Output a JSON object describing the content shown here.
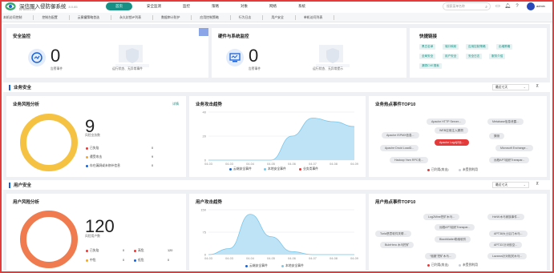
{
  "app": {
    "title": "深信服入侵防御系统",
    "version": "8.0.85",
    "subtitle": "AF80001 AF",
    "user": "admin"
  },
  "nav": [
    "首页",
    "安全监测",
    "监控",
    "策略",
    "对象",
    "网络",
    "系统"
  ],
  "search": {
    "placeholder": "搜索菜单名称"
  },
  "tabs": [
    "本机访问控制",
    "控制台配置",
    "云蜜罐策略首选",
    "永久封锁IP列表",
    "数据审计防护",
    "应用控制策略",
    "行为日志",
    "用户安全",
    "单机访问列表"
  ],
  "security_monitor": {
    "title": "安全监控",
    "count": "0",
    "label": "告警事件",
    "hint": "运行状态、无异常事件"
  },
  "hardware": {
    "title": "硬件与系统监控",
    "count": "0",
    "label": "告警事件",
    "hint": "运行状态、无异常提示"
  },
  "quick_links": {
    "title": "快捷链接",
    "items": [
      "黑白名单",
      "端口映射",
      "应用控制策略",
      "出墙策略",
      "全局安全",
      "用户安全",
      "安全日志",
      "服务介绍",
      "漏洞CVE搜索"
    ]
  },
  "business": {
    "section_title": "业务安全",
    "range": "最近七天",
    "risk": {
      "title": "业务风险分析",
      "link": "详情",
      "count": "9",
      "label": "风险业务数",
      "rows": [
        {
          "label": "已失陷",
          "value": "0",
          "color": "#e5393a"
        },
        {
          "label": "遭受攻击",
          "value": "9",
          "color": "#f5a623"
        },
        {
          "label": "存在漏洞或未修补信息",
          "value": "0",
          "color": "#1a63d6"
        }
      ]
    },
    "trend": {
      "title": "业务攻击趋势",
      "legend": [
        "云端安全事件",
        "本地安全事件",
        "业务类事件"
      ]
    },
    "top10": {
      "title": "业务热点事件TOP10",
      "legend": [
        "已利用(攻击)",
        "未受到利用"
      ],
      "tags": [
        "Apache HTTP Server...",
        "Metabase信息泄露...",
        "WEB应用注入漏洞",
        "Apache ISPMX信息...",
        "Apache Log4j2远...",
        "猜测",
        "Apache Druid LoadD...",
        "Microsoft Exchange...",
        "Hadoop Yarn RPC未...",
        "远程APT组织Transpar..."
      ]
    }
  },
  "user": {
    "section_title": "用户安全",
    "range": "最近七天",
    "risk": {
      "title": "用户风险分析",
      "count": "120",
      "label": "风险用户数",
      "rows": [
        {
          "label": "已失陷",
          "value": "0",
          "color": "#e5393a"
        },
        {
          "label": "中危",
          "value": "0",
          "color": "#f5a623"
        },
        {
          "label": "高危",
          "value": "120",
          "color": "#e5393a"
        },
        {
          "label": "低危",
          "value": "0",
          "color": "#1a63d6"
        }
      ]
    },
    "trend": {
      "title": "用户攻击趋势",
      "legend": [
        "云端安全事件",
        "本地安全事件"
      ]
    },
    "top10": {
      "title": "用户热点事件TOP10",
      "legend": [
        "已利用(攻击)",
        "未受到利用"
      ],
      "tags": [
        "Log2Mine挖矿木马...",
        "HxNK木马家族事件...",
        "远程APT组织Transpar...",
        "Turla恶意软件关联...",
        "APT38大士后门木马...",
        "BlackMatter勒索软件",
        "BuleHero 木马挖矿",
        "APT33 针对航空...",
        "“驱魔”挖矿木马...",
        "Lazarus针对相关木马..."
      ]
    }
  },
  "chart_data": [
    {
      "type": "area",
      "title": "业务攻击趋势",
      "x": [
        "04-03",
        "04-03",
        "04-04",
        "04-05",
        "04-06",
        "04-07",
        "04-08",
        "04-09"
      ],
      "ylim": [
        0,
        40
      ],
      "series": [
        {
          "name": "云端安全事件",
          "values": [
            0,
            0,
            0,
            0,
            20,
            35,
            32,
            28
          ]
        }
      ]
    },
    {
      "type": "area",
      "title": "用户攻击趋势",
      "x": [
        "04-03",
        "04-03",
        "04-04",
        "04-05",
        "04-06",
        "04-07",
        "04-08",
        "04-09"
      ],
      "ylim": [
        0,
        150
      ],
      "series": [
        {
          "name": "云端安全事件",
          "values": [
            0,
            20,
            135,
            60,
            10,
            0,
            0,
            0
          ]
        }
      ]
    }
  ]
}
